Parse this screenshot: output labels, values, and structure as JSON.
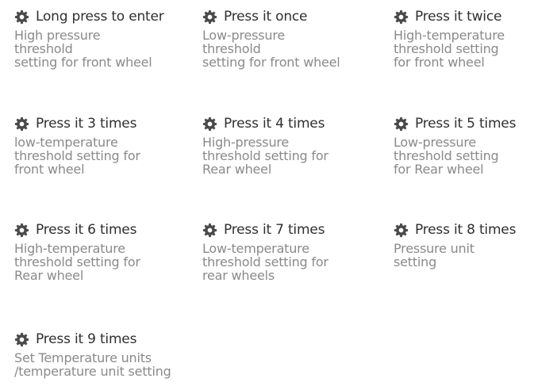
{
  "items": [
    {
      "label": "Long press to enter",
      "desc": "High pressure\nthreshold\nsetting for front wheel",
      "icon": "gear-icon"
    },
    {
      "label": "Press it once",
      "desc": "Low-pressure\nthreshold\nsetting for front wheel",
      "icon": "gear-icon"
    },
    {
      "label": "Press it twice",
      "desc": "High-temperature\nthreshold setting\nfor front wheel",
      "icon": "gear-icon"
    },
    {
      "label": "Press it 3 times",
      "desc": "low-temperature\nthreshold setting for\nfront wheel",
      "icon": "gear-icon"
    },
    {
      "label": "Press it 4 times",
      "desc": "High-pressure\nthreshold setting for\nRear wheel",
      "icon": "gear-icon"
    },
    {
      "label": "Press it 5 times",
      "desc": "Low-pressure\nthreshold setting\nfor Rear wheel",
      "icon": "gear-icon"
    },
    {
      "label": "Press it 6 times",
      "desc": "High-temperature\nthreshold setting for\nRear wheel",
      "icon": "gear-icon"
    },
    {
      "label": "Press it 7 times",
      "desc": "Low-temperature\nthreshold setting for\nrear wheels",
      "icon": "gear-icon"
    },
    {
      "label": "Press it 8 times",
      "desc": "Pressure unit\nsetting",
      "icon": "gear-icon"
    },
    {
      "label": "Press it 9 times",
      "desc": "Set Temperature units\n/temperature unit setting",
      "icon": "gear-icon"
    }
  ],
  "colors": {
    "icon": "#4a4a4a",
    "label": "#2f2f2f",
    "description": "#8a8a8a",
    "background": "#ffffff"
  }
}
